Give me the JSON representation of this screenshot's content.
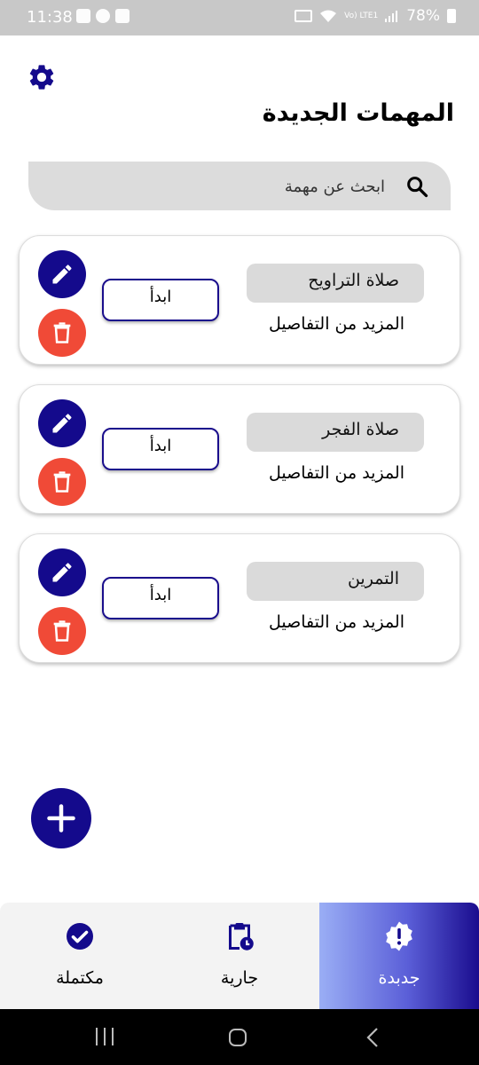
{
  "status_bar": {
    "time": "11:38",
    "battery": "78%",
    "network": "Vo) LTE1"
  },
  "header": {
    "title": "المهمات الجديدة"
  },
  "search": {
    "placeholder": "ابحث عن مهمة"
  },
  "tasks": [
    {
      "name": "صلاة التراويح",
      "details": "المزيد من التفاصيل",
      "start_label": "ابدأ"
    },
    {
      "name": "صلاة الفجر",
      "details": "المزيد من التفاصيل",
      "start_label": "ابدأ"
    },
    {
      "name": "التمرين",
      "details": "المزيد من التفاصيل",
      "start_label": "ابدأ"
    }
  ],
  "bottom_nav": {
    "items": [
      {
        "label": "مكتملة",
        "icon": "check-circle-icon"
      },
      {
        "label": "جارية",
        "icon": "clipboard-clock-icon"
      },
      {
        "label": "جدبدة",
        "icon": "alert-badge-icon",
        "active": true
      }
    ]
  },
  "colors": {
    "primary": "#140a8c",
    "danger": "#f04a37",
    "pill": "#dadada",
    "search_bg": "#dcdcdc"
  }
}
